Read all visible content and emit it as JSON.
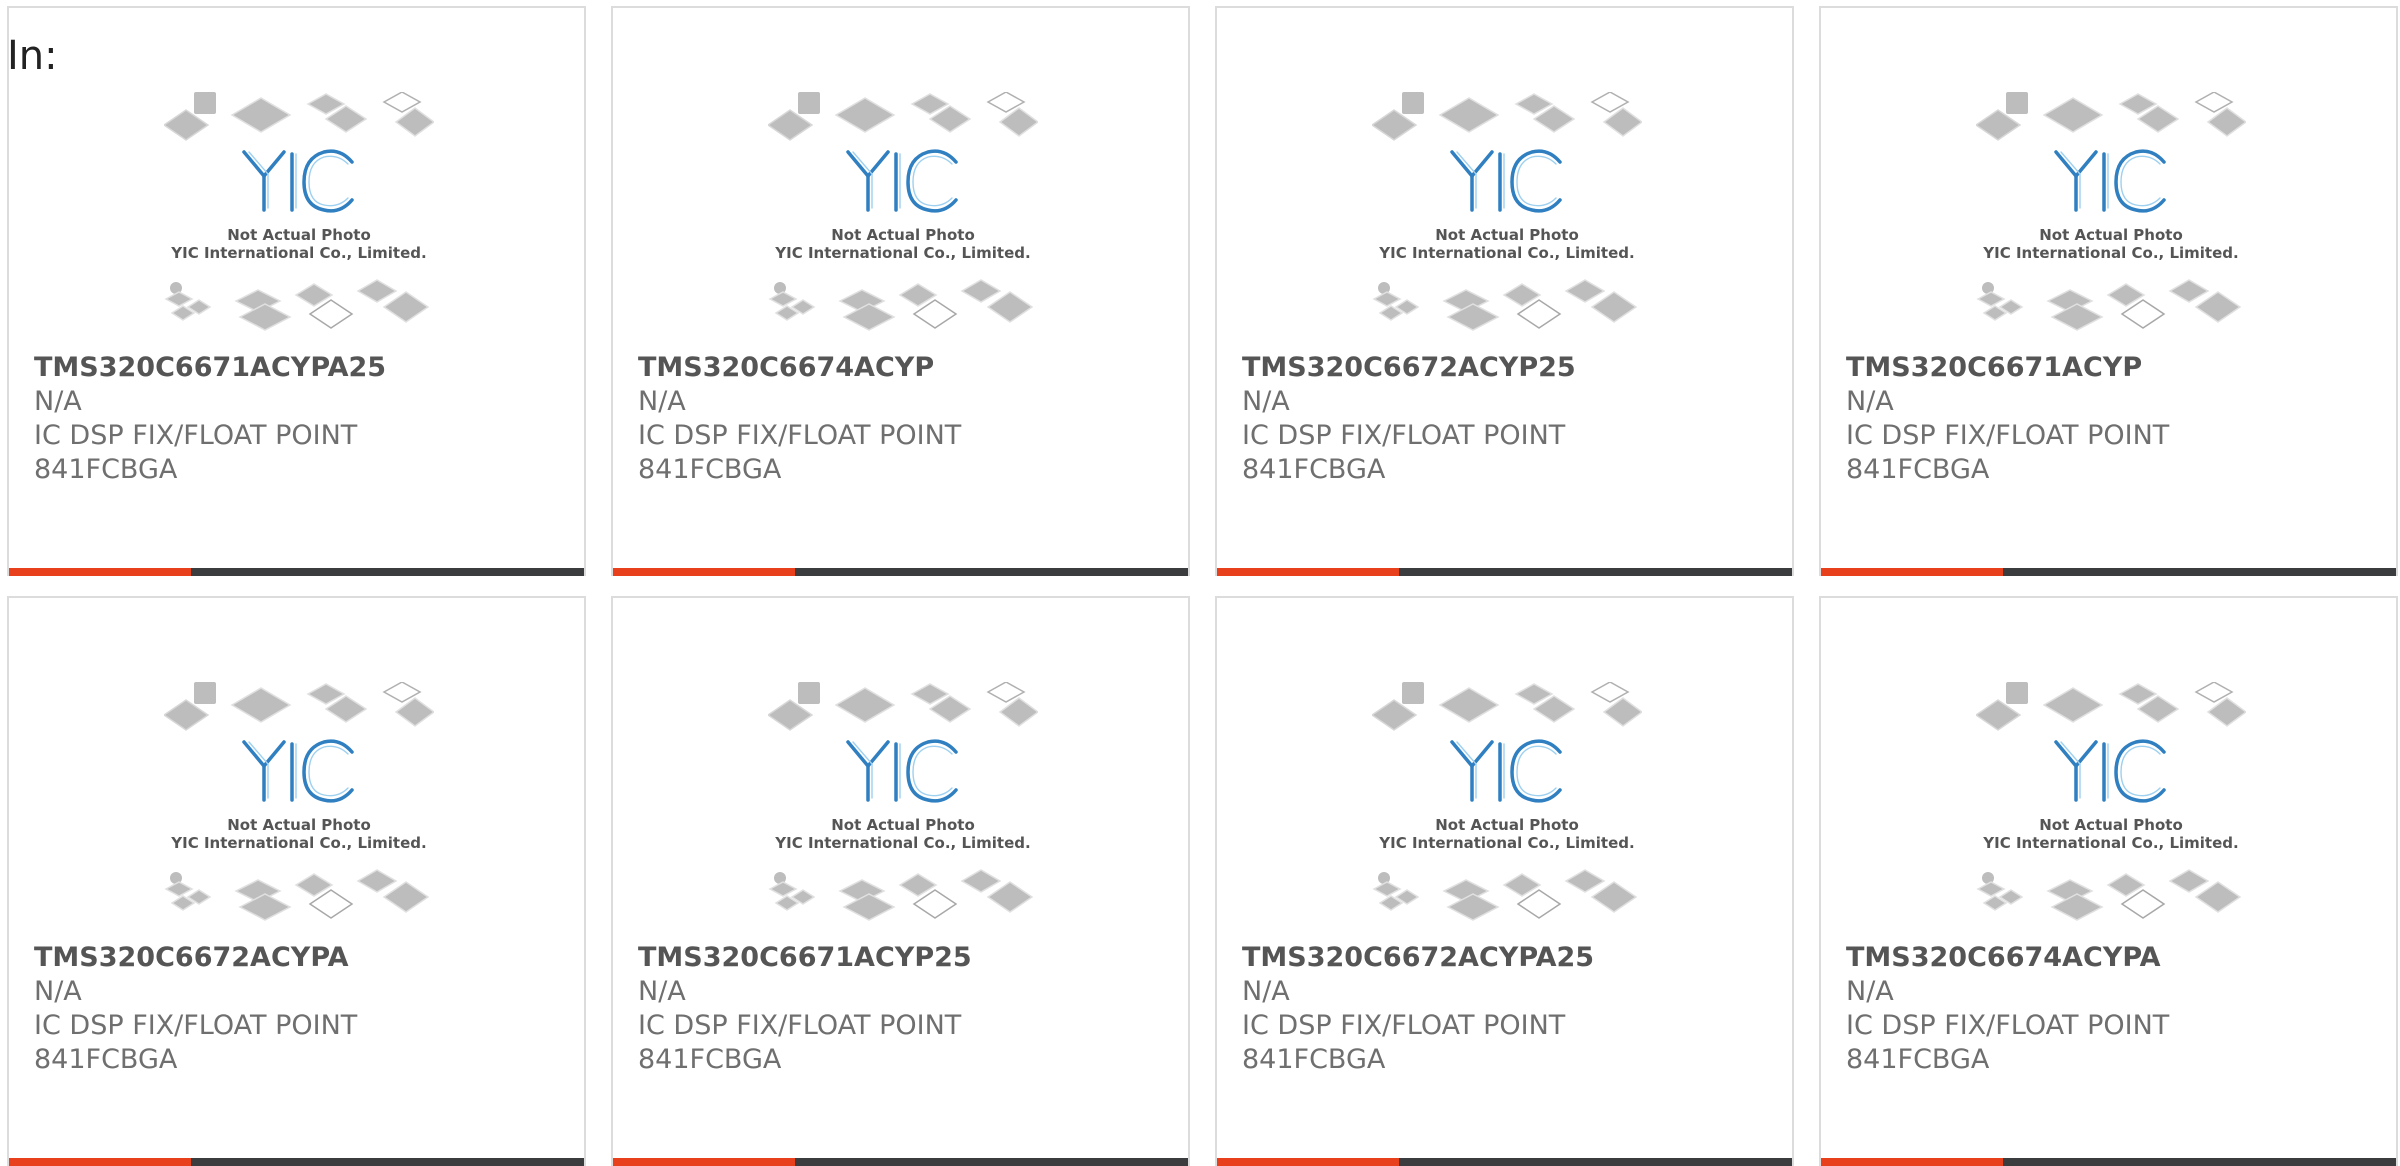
{
  "header": {
    "label": "In:"
  },
  "placeholder": {
    "logo_text": "YIC",
    "caption_line1": "Not Actual Photo",
    "caption_line2": "YIC International Co., Limited."
  },
  "colors": {
    "accent": "#e8401c",
    "stripe_dark": "#3a3c3e",
    "logo_blue": "#2f7fc1",
    "chip_gray": "#bdbdbd"
  },
  "products": [
    {
      "part_number": "TMS320C6671ACYPA25",
      "manufacturer": "N/A",
      "desc_line1": "IC DSP FIX/FLOAT POINT",
      "desc_line2": "841FCBGA"
    },
    {
      "part_number": "TMS320C6674ACYP",
      "manufacturer": "N/A",
      "desc_line1": "IC DSP FIX/FLOAT POINT",
      "desc_line2": "841FCBGA"
    },
    {
      "part_number": "TMS320C6672ACYP25",
      "manufacturer": "N/A",
      "desc_line1": "IC DSP FIX/FLOAT POINT",
      "desc_line2": "841FCBGA"
    },
    {
      "part_number": "TMS320C6671ACYP",
      "manufacturer": "N/A",
      "desc_line1": "IC DSP FIX/FLOAT POINT",
      "desc_line2": "841FCBGA"
    },
    {
      "part_number": "TMS320C6672ACYPA",
      "manufacturer": "N/A",
      "desc_line1": "IC DSP FIX/FLOAT POINT",
      "desc_line2": "841FCBGA"
    },
    {
      "part_number": "TMS320C6671ACYP25",
      "manufacturer": "N/A",
      "desc_line1": "IC DSP FIX/FLOAT POINT",
      "desc_line2": "841FCBGA"
    },
    {
      "part_number": "TMS320C6672ACYPA25",
      "manufacturer": "N/A",
      "desc_line1": "IC DSP FIX/FLOAT POINT",
      "desc_line2": "841FCBGA"
    },
    {
      "part_number": "TMS320C6674ACYPA",
      "manufacturer": "N/A",
      "desc_line1": "IC DSP FIX/FLOAT POINT",
      "desc_line2": "841FCBGA"
    }
  ]
}
